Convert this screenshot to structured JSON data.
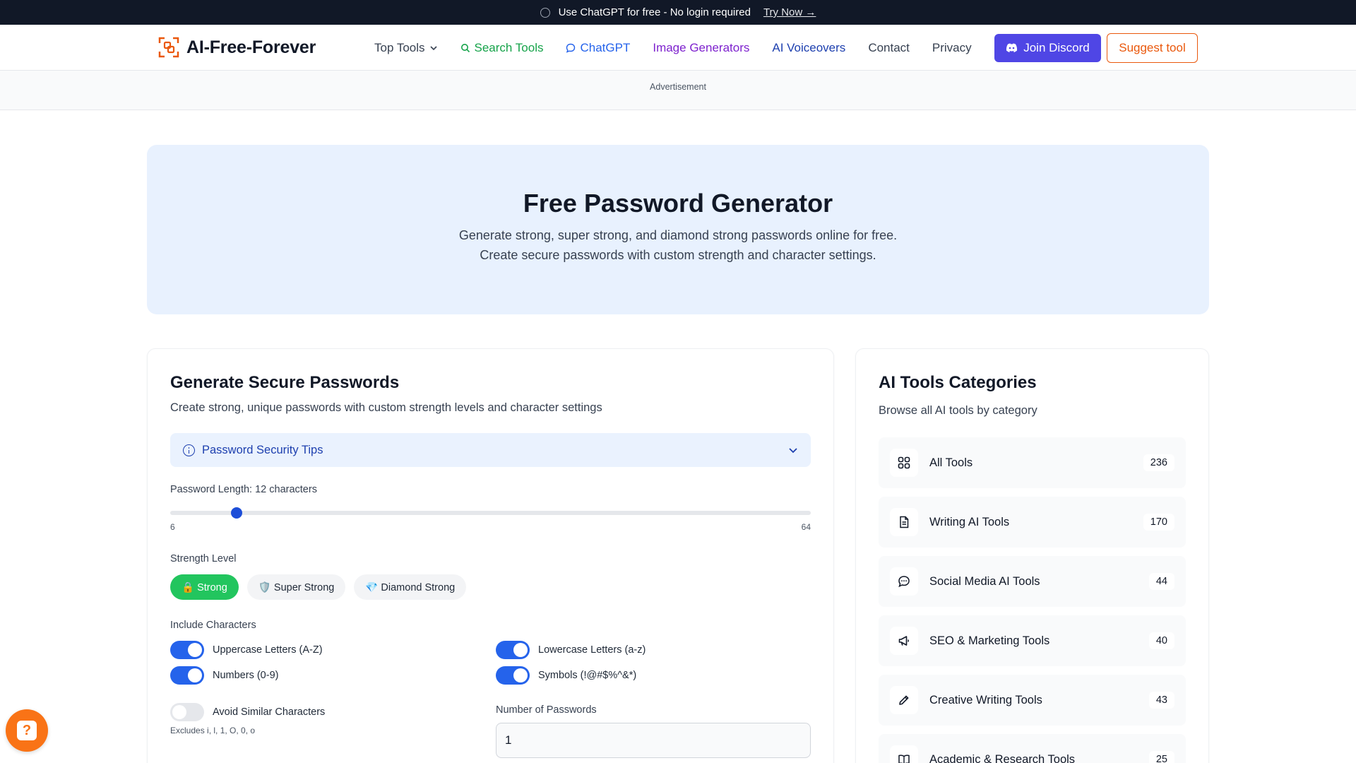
{
  "banner": {
    "text": "Use ChatGPT for free - No login required",
    "cta": "Try Now →"
  },
  "nav": {
    "brand": "AI-Free-Forever",
    "links": {
      "top_tools": "Top Tools",
      "search_tools": "Search Tools",
      "chatgpt": "ChatGPT",
      "image_generators": "Image Generators",
      "ai_voiceovers": "AI Voiceovers",
      "contact": "Contact",
      "privacy": "Privacy"
    },
    "join_discord": "Join Discord",
    "suggest_tool": "Suggest tool"
  },
  "ad_label": "Advertisement",
  "hero": {
    "title": "Free Password Generator",
    "line1": "Generate strong, super strong, and diamond strong passwords online for free.",
    "line2": "Create secure passwords with custom strength and character settings."
  },
  "generator": {
    "title": "Generate Secure Passwords",
    "subtitle": "Create strong, unique passwords with custom strength levels and character settings",
    "tips_label": "Password Security Tips",
    "length_label": "Password Length: 12 characters",
    "length_min": "6",
    "length_max": "64",
    "length_value": 12,
    "strength_label": "Strength Level",
    "strength_options": [
      "🔒 Strong",
      "🛡️ Super Strong",
      "💎 Diamond Strong"
    ],
    "strength_selected": "Strong",
    "include_label": "Include Characters",
    "options": {
      "uppercase": "Uppercase Letters (A-Z)",
      "lowercase": "Lowercase Letters (a-z)",
      "numbers": "Numbers (0-9)",
      "symbols": "Symbols (!@#$%^&*)",
      "avoid_similar": "Avoid Similar Characters",
      "avoid_similar_hint": "Excludes i, l, 1, O, 0, o"
    },
    "option_states": {
      "uppercase": true,
      "lowercase": true,
      "numbers": true,
      "symbols": true,
      "avoid_similar": false
    },
    "count_label": "Number of Passwords",
    "count_value": "1"
  },
  "categories": {
    "title": "AI Tools Categories",
    "subtitle": "Browse all AI tools by category",
    "items": [
      {
        "name": "All Tools",
        "count": "236",
        "icon": "grid-icon"
      },
      {
        "name": "Writing AI Tools",
        "count": "170",
        "icon": "document-icon"
      },
      {
        "name": "Social Media AI Tools",
        "count": "44",
        "icon": "chat-bubble-icon"
      },
      {
        "name": "SEO & Marketing Tools",
        "count": "40",
        "icon": "megaphone-icon"
      },
      {
        "name": "Creative Writing Tools",
        "count": "43",
        "icon": "pencil-icon"
      },
      {
        "name": "Academic & Research Tools",
        "count": "25",
        "icon": "book-icon"
      }
    ]
  },
  "colors": {
    "accent_blue": "#2563eb",
    "discord": "#4f46e5",
    "orange": "#ea580c",
    "green": "#22c55e"
  }
}
